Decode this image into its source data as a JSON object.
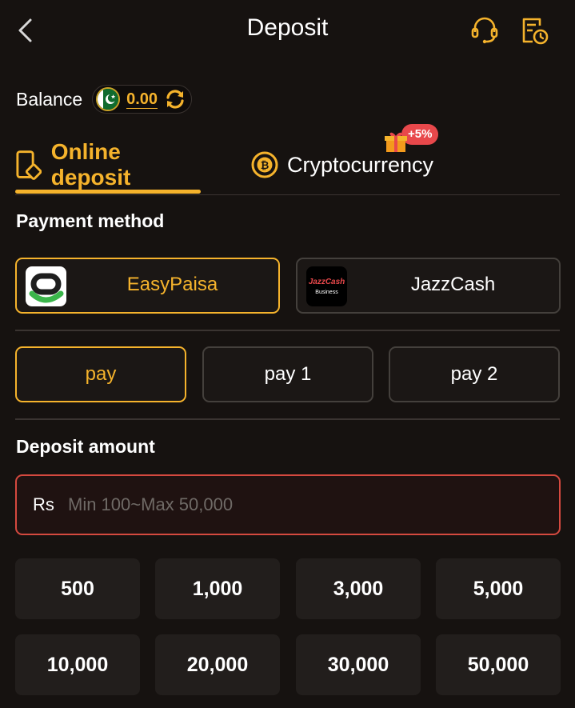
{
  "header": {
    "title": "Deposit",
    "back_icon": "back-arrow-icon",
    "support_icon": "headset-icon",
    "history_icon": "deposit-history-icon"
  },
  "balance": {
    "label": "Balance",
    "value": "0.00",
    "currency_flag": "pakistan-flag",
    "refresh_icon": "refresh-icon"
  },
  "tabs": [
    {
      "label": "Online deposit",
      "icon": "mobile-deposit-icon",
      "active": true
    },
    {
      "label": "Cryptocurrency",
      "icon": "bitcoin-icon",
      "active": false,
      "badge": "+5%"
    }
  ],
  "payment_method": {
    "title": "Payment method",
    "options": [
      {
        "label": "EasyPaisa",
        "selected": true
      },
      {
        "label": "JazzCash",
        "selected": false,
        "logo_text": "JazzCash",
        "logo_sub": "Business"
      }
    ]
  },
  "channels": [
    {
      "label": "pay",
      "selected": true
    },
    {
      "label": "pay 1",
      "selected": false
    },
    {
      "label": "pay 2",
      "selected": false
    }
  ],
  "deposit_amount": {
    "title": "Deposit amount",
    "currency": "Rs",
    "value": "",
    "placeholder": "Min 100~Max 50,000"
  },
  "presets": [
    "500",
    "1,000",
    "3,000",
    "5,000",
    "10,000",
    "20,000",
    "30,000",
    "50,000"
  ],
  "colors": {
    "accent": "#f5b32c",
    "background": "#161210",
    "error_border": "#d4493f",
    "badge": "#e8484b"
  }
}
